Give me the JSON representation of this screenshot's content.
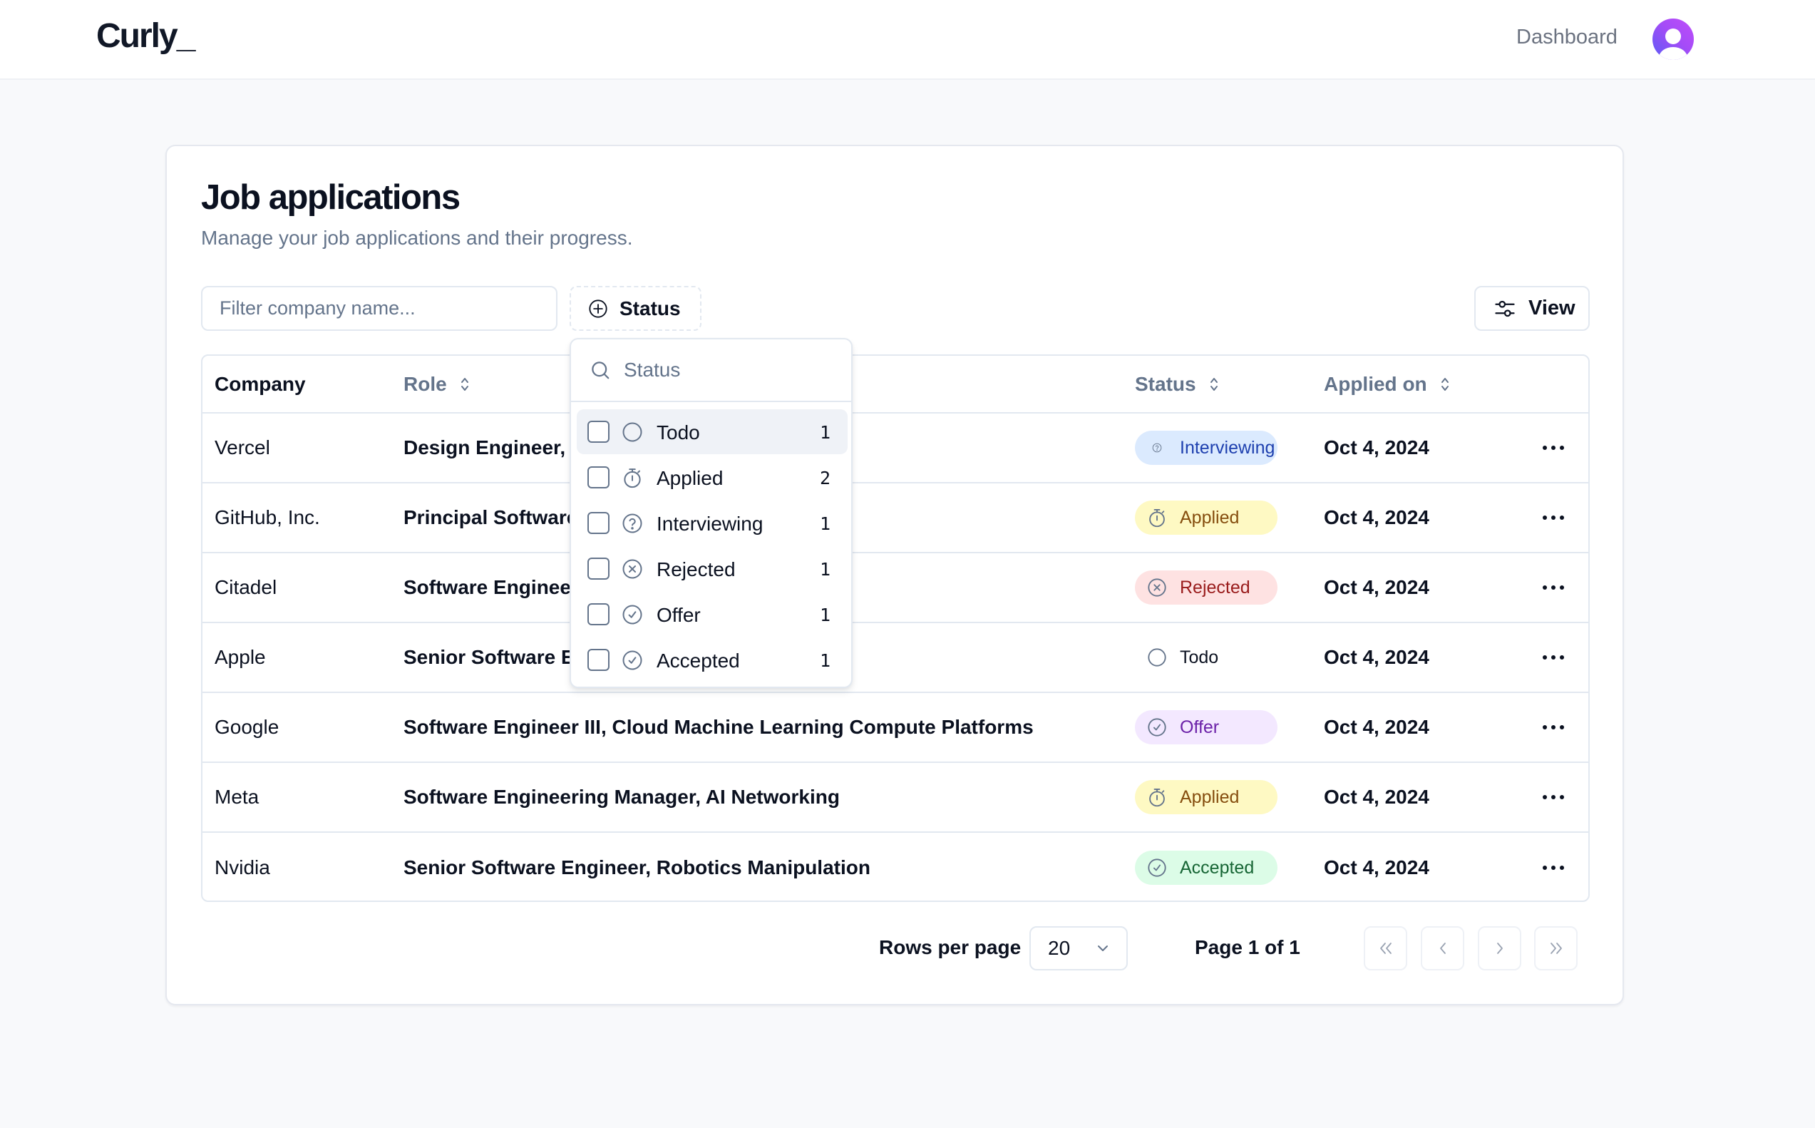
{
  "app": {
    "logo": "Curly_",
    "nav_link": "Dashboard",
    "avatar_icon": "user-icon"
  },
  "page": {
    "title": "Job applications",
    "subtitle": "Manage your job applications and their progress."
  },
  "toolbar": {
    "filter_placeholder": "Filter company name...",
    "filter_value": "",
    "status_button_label": "Status",
    "status_button_icon": "plus-circle-icon",
    "view_button_label": "View",
    "view_button_icon": "sliders-icon"
  },
  "table": {
    "columns": [
      {
        "label": "Company",
        "sortable": false
      },
      {
        "label": "Role",
        "sortable": true
      },
      {
        "label": "Status",
        "sortable": true
      },
      {
        "label": "Applied on",
        "sortable": true
      }
    ],
    "rows": [
      {
        "company": "Vercel",
        "role": "Design Engineer, I",
        "status": "Interviewing",
        "applied_on": "Oct 4, 2024"
      },
      {
        "company": "GitHub, Inc.",
        "role": "Principal Software",
        "status": "Applied",
        "applied_on": "Oct 4, 2024"
      },
      {
        "company": "Citadel",
        "role": "Software Engineer",
        "status": "Rejected",
        "applied_on": "Oct 4, 2024"
      },
      {
        "company": "Apple",
        "role": "Senior Software E",
        "status": "Todo",
        "applied_on": "Oct 4, 2024"
      },
      {
        "company": "Google",
        "role": "Software Engineer III, Cloud Machine Learning Compute Platforms",
        "status": "Offer",
        "applied_on": "Oct 4, 2024"
      },
      {
        "company": "Meta",
        "role": "Software Engineering Manager, AI Networking",
        "status": "Applied",
        "applied_on": "Oct 4, 2024"
      },
      {
        "company": "Nvidia",
        "role": "Senior Software Engineer, Robotics Manipulation",
        "status": "Accepted",
        "applied_on": "Oct 4, 2024"
      }
    ],
    "row_action_icon": "more-horizontal-icon"
  },
  "status_styles": {
    "Interviewing": {
      "bg": "#dbeafe",
      "fg": "#1e40af",
      "icon": "help-circle-icon"
    },
    "Applied": {
      "bg": "#fef9c3",
      "fg": "#854d0e",
      "icon": "timer-icon"
    },
    "Rejected": {
      "bg": "#fee2e2",
      "fg": "#991b1b",
      "icon": "x-circle-icon"
    },
    "Todo": {
      "bg": "transparent",
      "fg": "#0b1120",
      "icon": "circle-icon"
    },
    "Offer": {
      "bg": "#f3e8ff",
      "fg": "#6b21a8",
      "icon": "check-circle-icon"
    },
    "Accepted": {
      "bg": "#dcfce7",
      "fg": "#166534",
      "icon": "check-circle-icon"
    }
  },
  "pagination": {
    "rows_per_page_label": "Rows per page",
    "rows_per_page_value": "20",
    "page_label": "Page 1 of 1",
    "first_icon": "chevrons-left-icon",
    "prev_icon": "chevron-left-icon",
    "next_icon": "chevron-right-icon",
    "last_icon": "chevrons-right-icon"
  },
  "status_dropdown": {
    "search_placeholder": "Status",
    "search_value": "",
    "highlighted_index": 0,
    "options": [
      {
        "label": "Todo",
        "count": "1",
        "checked": false,
        "icon": "circle-icon"
      },
      {
        "label": "Applied",
        "count": "2",
        "checked": false,
        "icon": "timer-icon"
      },
      {
        "label": "Interviewing",
        "count": "1",
        "checked": false,
        "icon": "help-circle-icon"
      },
      {
        "label": "Rejected",
        "count": "1",
        "checked": false,
        "icon": "x-circle-icon"
      },
      {
        "label": "Offer",
        "count": "1",
        "checked": false,
        "icon": "check-circle-icon"
      },
      {
        "label": "Accepted",
        "count": "1",
        "checked": false,
        "icon": "check-circle-icon"
      }
    ]
  }
}
